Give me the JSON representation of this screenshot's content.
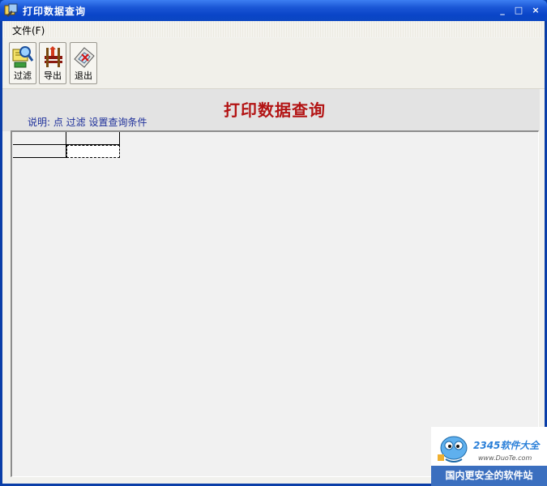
{
  "window": {
    "title": "打印数据查询",
    "minimize": "_",
    "maximize": "□",
    "close": "×"
  },
  "menu": {
    "file": "文件(F)"
  },
  "toolbar": {
    "filter": "过滤",
    "export": "导出",
    "exit": "退出"
  },
  "header": {
    "title": "打印数据查询",
    "hint": "说明: 点 过滤 设置查询条件"
  },
  "watermark": {
    "brand": "2345软件大全",
    "url": "www.DuoTe.com",
    "footer": "国内更安全的软件站"
  }
}
